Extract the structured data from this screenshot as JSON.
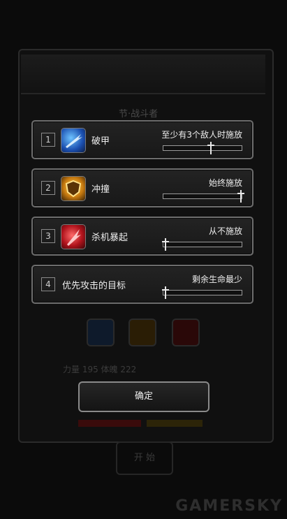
{
  "background": {
    "title": "节·战斗者",
    "stats": "力量  195    体魄  222",
    "start_button": "开 始",
    "watermark": "GAMERSKY"
  },
  "skills": [
    {
      "index": "1",
      "name": "破甲",
      "icon": "armor-break-icon",
      "condition": "至少有3个敌人时施放",
      "level": 0.6
    },
    {
      "index": "2",
      "name": "冲撞",
      "icon": "shield-charge-icon",
      "condition": "始终施放",
      "level": 1.0
    },
    {
      "index": "3",
      "name": "杀机暴起",
      "icon": "killing-intent-icon",
      "condition": "从不施放",
      "level": 0.0
    },
    {
      "index": "4",
      "name": "优先攻击的目标",
      "icon": "",
      "condition": "剩余生命最少",
      "level": 0.0
    }
  ],
  "confirm_label": "确定",
  "colors": {
    "frame": "#6d6d6d",
    "card": "#1e1e1e",
    "text": "#ededed"
  }
}
